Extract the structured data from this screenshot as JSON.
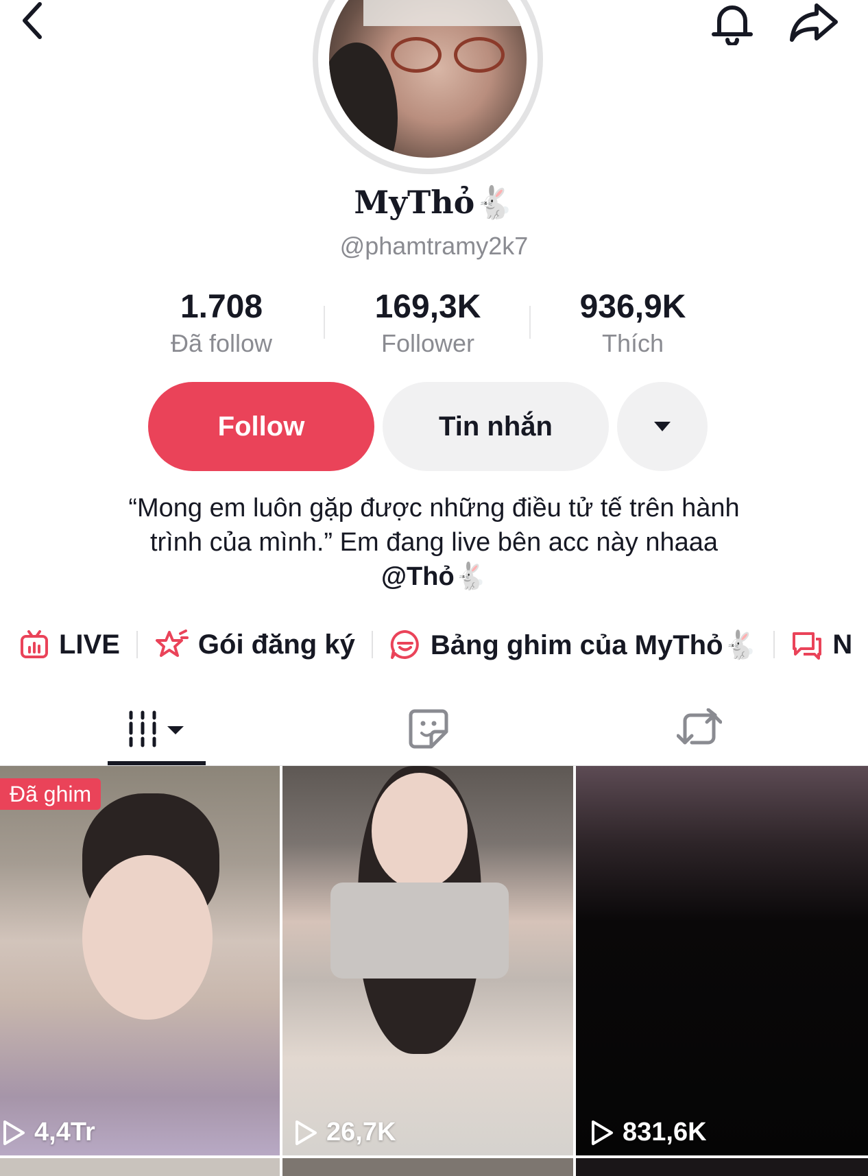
{
  "header": {
    "back_icon": "chevron-left-icon",
    "bell_icon": "bell-icon",
    "share_icon": "share-arrow-icon"
  },
  "profile": {
    "display_name": "MyThỏ🐇",
    "handle": "@phamtramy2k7"
  },
  "stats": [
    {
      "value": "1.708",
      "label": "Đã follow"
    },
    {
      "value": "169,3K",
      "label": "Follower"
    },
    {
      "value": "936,9K",
      "label": "Thích"
    }
  ],
  "actions": {
    "follow_label": "Follow",
    "message_label": "Tin nhắn",
    "more_icon": "caret-down-icon"
  },
  "bio": {
    "line1": "“Mong em luôn gặp được những điều tử tế trên hành",
    "line2": "trình của mình.” Em đang live bên acc này nhaaa",
    "mention": "@Thỏ🐇"
  },
  "links": [
    {
      "label": "LIVE",
      "icon": "live-tv-icon"
    },
    {
      "label": "Gói đăng ký",
      "icon": "subscription-star-icon"
    },
    {
      "label": "Bảng ghim của MyThỏ🐇",
      "icon": "pin-board-icon"
    },
    {
      "label": "N",
      "icon": "chat-icon"
    }
  ],
  "tabs": [
    {
      "name": "videos",
      "icon": "grid-columns-icon"
    },
    {
      "name": "stickers",
      "icon": "sticker-icon"
    },
    {
      "name": "reposts",
      "icon": "repost-icon"
    }
  ],
  "videos": [
    {
      "views": "4,4Tr",
      "badge": "Đã ghim"
    },
    {
      "views": "26,7K",
      "badge": ""
    },
    {
      "views": "831,6K",
      "badge": ""
    }
  ],
  "colors": {
    "accent": "#ea4359",
    "text": "#161823",
    "muted": "#8a8b91",
    "button_bg": "#f1f1f2"
  }
}
